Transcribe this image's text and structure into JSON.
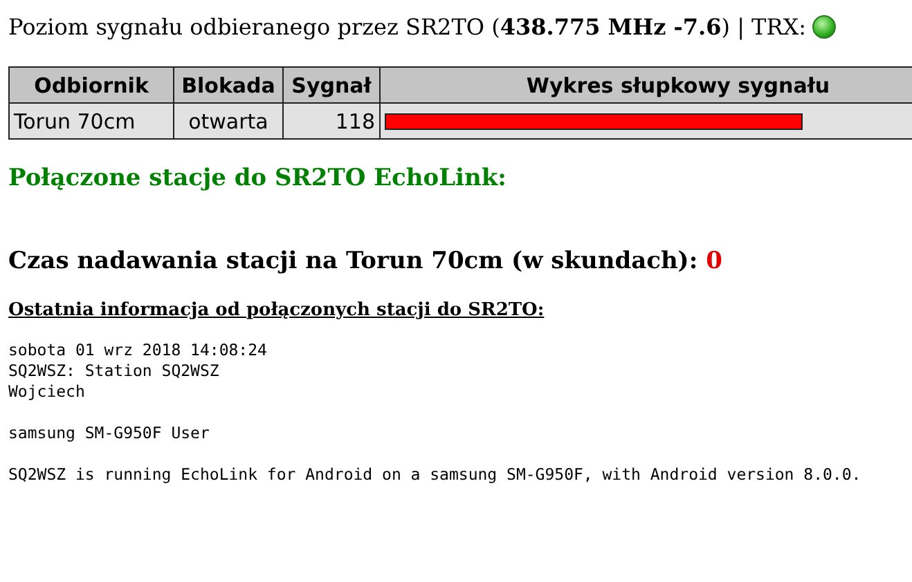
{
  "header": {
    "text": "Poziom sygnału odbieranego przez SR2TO (**438.775 MHz -7.6**) | TRX:",
    "trx_on": true
  },
  "table": {
    "columns": [
      "Odbiornik",
      "Blokada",
      "Sygnał",
      "Wykres słupkowy sygnału"
    ],
    "rows": [
      {
        "receiver": "Torun 70cm",
        "lock": "otwarta",
        "signal": "118"
      }
    ]
  },
  "connected_heading": "Połączone stacje do SR2TO EchoLink:",
  "tx_time": {
    "label": "Czas nadawania stacji na Torun 70cm (w skundach):",
    "value": "0"
  },
  "last_info": {
    "heading": "Ostatnia informacja od połączonych stacji do SR2TO:",
    "paragraphs": [
      [
        "sobota 01 wrz 2018 14:08:24",
        "SQ2WSZ: Station SQ2WSZ",
        "Wojciech"
      ],
      [
        "samsung SM-G950F User"
      ],
      [
        "SQ2WSZ is running EchoLink for Android on a samsung SM-G950F, with Android version 8.0.0."
      ]
    ]
  }
}
